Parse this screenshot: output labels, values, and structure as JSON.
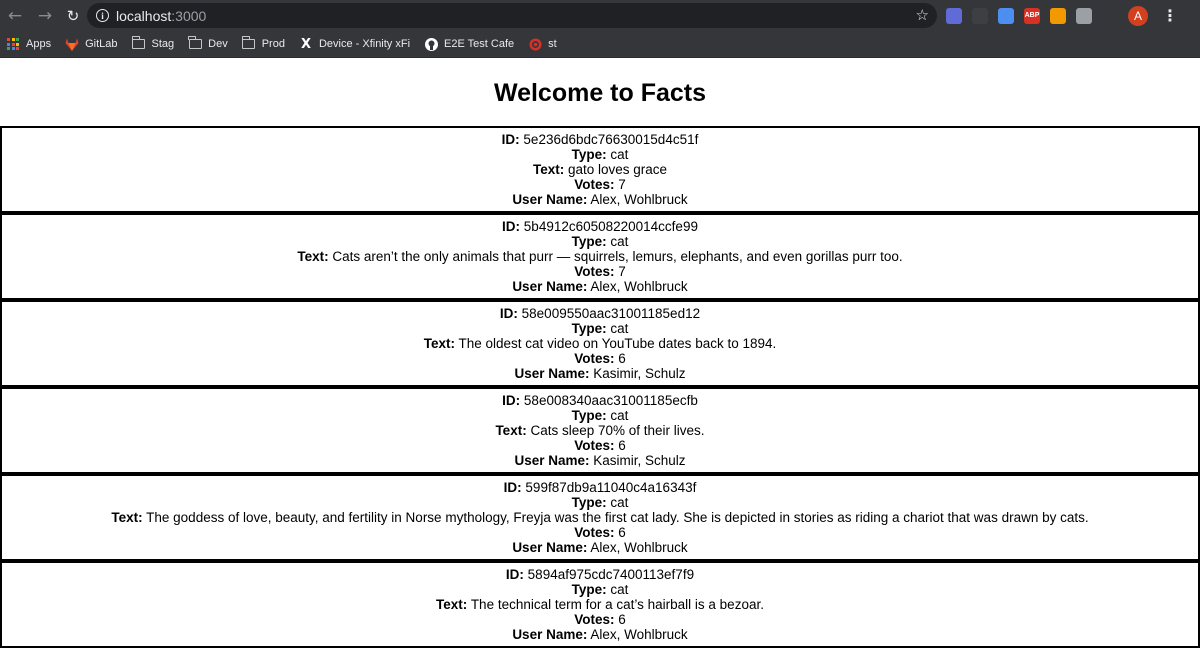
{
  "browser": {
    "url_host": "localhost",
    "url_port": ":3000",
    "avatar_letter": "A",
    "extensions": [
      {
        "name": "extension-1-icon",
        "color": "#5f6bd6",
        "label": ""
      },
      {
        "name": "extension-2-icon",
        "color": "#3c4043",
        "label": ""
      },
      {
        "name": "extension-3-icon",
        "color": "#4d8ff0",
        "label": ""
      },
      {
        "name": "adblock-plus-icon",
        "color": "#d93025",
        "label": "ABP"
      },
      {
        "name": "calculator-icon",
        "color": "#f29900",
        "label": ""
      },
      {
        "name": "extension-6-icon",
        "color": "#9aa0a6",
        "label": ""
      },
      {
        "name": "media-control-icon",
        "color": "#35363a",
        "label": ""
      }
    ]
  },
  "bookmarks": [
    {
      "label": "Apps",
      "icon": "apps-grid-icon"
    },
    {
      "label": "GitLab",
      "icon": "gitlab-icon"
    },
    {
      "label": "Stag",
      "icon": "folder-icon"
    },
    {
      "label": "Dev",
      "icon": "folder-icon"
    },
    {
      "label": "Prod",
      "icon": "folder-icon"
    },
    {
      "label": "Device - Xfinity xFi",
      "icon": "xfinity-icon"
    },
    {
      "label": "E2E Test Cafe",
      "icon": "github-icon"
    },
    {
      "label": "st",
      "icon": "target-icon"
    }
  ],
  "page": {
    "title": "Welcome to Facts",
    "labels": {
      "id": "ID:",
      "type": "Type:",
      "text": "Text:",
      "votes": "Votes:",
      "user": "User Name:"
    },
    "facts": [
      {
        "id": "5e236d6bdc76630015d4c51f",
        "type": "cat",
        "text": "gato loves grace",
        "votes": "7",
        "user": "Alex, Wohlbruck"
      },
      {
        "id": "5b4912c60508220014ccfe99",
        "type": "cat",
        "text": "Cats aren’t the only animals that purr — squirrels, lemurs, elephants, and even gorillas purr too.",
        "votes": "7",
        "user": "Alex, Wohlbruck"
      },
      {
        "id": "58e009550aac31001185ed12",
        "type": "cat",
        "text": "The oldest cat video on YouTube dates back to 1894.",
        "votes": "6",
        "user": "Kasimir, Schulz"
      },
      {
        "id": "58e008340aac31001185ecfb",
        "type": "cat",
        "text": "Cats sleep 70% of their lives.",
        "votes": "6",
        "user": "Kasimir, Schulz"
      },
      {
        "id": "599f87db9a11040c4a16343f",
        "type": "cat",
        "text": "The goddess of love, beauty, and fertility in Norse mythology, Freyja was the first cat lady. She is depicted in stories as riding a chariot that was drawn by cats.",
        "votes": "6",
        "user": "Alex, Wohlbruck"
      },
      {
        "id": "5894af975cdc7400113ef7f9",
        "type": "cat",
        "text": "The technical term for a cat’s hairball is a bezoar.",
        "votes": "6",
        "user": "Alex, Wohlbruck"
      }
    ]
  }
}
